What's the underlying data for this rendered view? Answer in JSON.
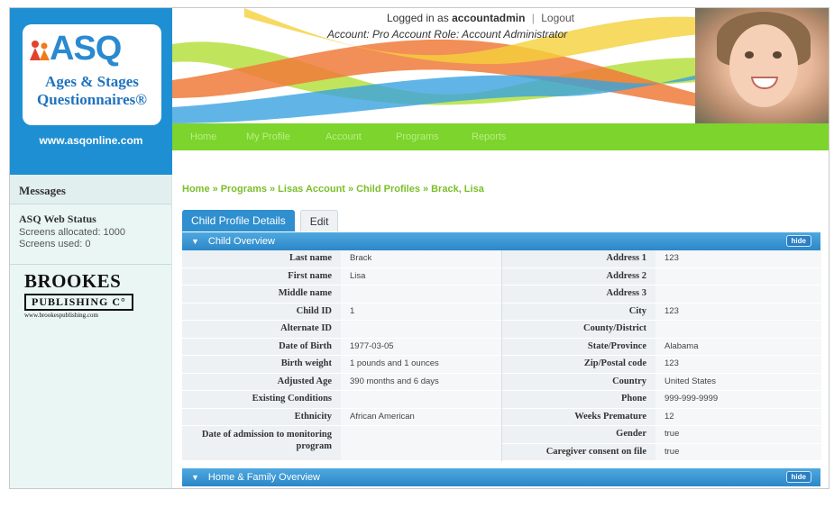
{
  "logo": {
    "brand": "ASQ",
    "line1": "Ages & Stages",
    "line2": "Questionnaires®",
    "url": "www.asqonline.com"
  },
  "header": {
    "logged_in_prefix": "Logged in as",
    "username": "accountadmin",
    "logout": "Logout",
    "account_line": "Account: Pro Account Role: Account Administrator"
  },
  "nav": [
    "Home",
    "My Profile",
    "Account",
    "Programs",
    "Reports"
  ],
  "sidebar": {
    "messages": "Messages",
    "status_title": "ASQ Web Status",
    "screens_allocated": "Screens allocated: 1000",
    "screens_used": "Screens used: 0",
    "publisher_line1": "BROOKES",
    "publisher_line2": "PUBLISHING C°",
    "publisher_url": "www.brookespublishing.com"
  },
  "breadcrumb": [
    "Home",
    "Programs",
    "Lisas Account",
    "Child Profiles",
    "Brack, Lisa"
  ],
  "tabs": {
    "active": "Child Profile Details",
    "edit": "Edit"
  },
  "sections": {
    "child_overview": "Child Overview",
    "home_family": "Home & Family Overview",
    "hide_label": "hide"
  },
  "left_fields": [
    {
      "label": "Last name",
      "value": "Brack"
    },
    {
      "label": "First name",
      "value": "Lisa"
    },
    {
      "label": "Middle name",
      "value": ""
    },
    {
      "label": "Child ID",
      "value": "1"
    },
    {
      "label": "Alternate ID",
      "value": ""
    },
    {
      "label": "Date of Birth",
      "value": "1977-03-05"
    },
    {
      "label": "Birth weight",
      "value": "1 pounds and 1 ounces"
    },
    {
      "label": "Adjusted Age",
      "value": "390 months and 6 days"
    },
    {
      "label": "Existing Conditions",
      "value": ""
    },
    {
      "label": "Ethnicity",
      "value": "African American"
    },
    {
      "label": "Date of admission to monitoring program",
      "value": ""
    }
  ],
  "right_fields": [
    {
      "label": "Address 1",
      "value": "123"
    },
    {
      "label": "Address 2",
      "value": ""
    },
    {
      "label": "Address 3",
      "value": ""
    },
    {
      "label": "City",
      "value": "123"
    },
    {
      "label": "County/District",
      "value": ""
    },
    {
      "label": "State/Province",
      "value": "Alabama"
    },
    {
      "label": "Zip/Postal code",
      "value": "123"
    },
    {
      "label": "Country",
      "value": "United States"
    },
    {
      "label": "Phone",
      "value": "999-999-9999"
    },
    {
      "label": "Weeks Premature",
      "value": "12"
    },
    {
      "label": "Gender",
      "value": "true"
    },
    {
      "label": "Caregiver consent on file",
      "value": "true"
    }
  ],
  "colors": {
    "brand_blue": "#1e8fd3",
    "nav_green": "#7dd42c",
    "breadcrumb_green": "#7bbf2a",
    "section_blue": "#2b87c8"
  }
}
